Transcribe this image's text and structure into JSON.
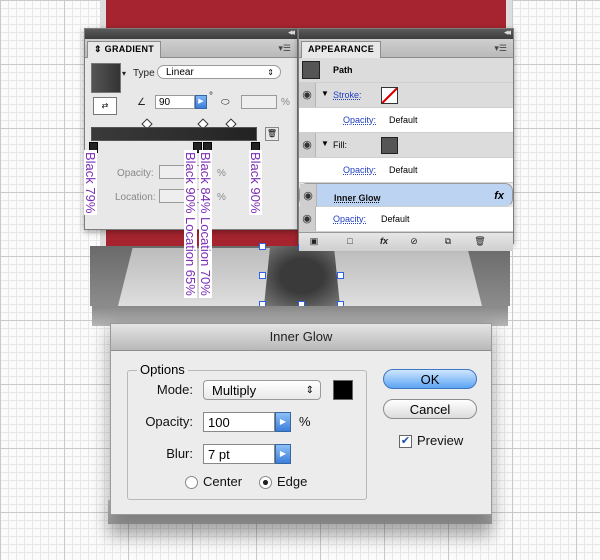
{
  "gradient_panel": {
    "tab": "GRADIENT",
    "type_label": "Type",
    "type_value": "Linear",
    "angle_value": "90",
    "degree_symbol": "°",
    "aspect_unit": "%",
    "opacity_label": "Opacity:",
    "opacity_unit": "%",
    "location_label": "Location:",
    "location_unit": "%"
  },
  "annotations": {
    "stop1": "Black 79%",
    "stop2a": "Black 84% Location 70%",
    "stop2b": "Black 90% Location 65%",
    "stop3": "Black 90%"
  },
  "appearance_panel": {
    "tab": "APPEARANCE",
    "path_label": "Path",
    "stroke_label": "Stroke:",
    "stroke_opacity_label": "Opacity:",
    "stroke_opacity_value": "Default",
    "fill_label": "Fill:",
    "fill_opacity_label": "Opacity:",
    "fill_opacity_value": "Default",
    "inner_glow_label": "Inner Glow",
    "fx_label": "fx",
    "opacity_label": "Opacity:",
    "opacity_value": "Default"
  },
  "dialog": {
    "title": "Inner Glow",
    "options_label": "Options",
    "mode_label": "Mode:",
    "mode_value": "Multiply",
    "opacity_label": "Opacity:",
    "opacity_value": "100",
    "opacity_unit": "%",
    "blur_label": "Blur:",
    "blur_value": "7 pt",
    "center_label": "Center",
    "edge_label": "Edge",
    "ok_label": "OK",
    "cancel_label": "Cancel",
    "preview_label": "Preview",
    "glow_color": "#000000"
  },
  "colors": {
    "accent_red": "#a6242f",
    "annotation_purple": "#7b2fb3",
    "selection_blue": "#2b62e6"
  }
}
